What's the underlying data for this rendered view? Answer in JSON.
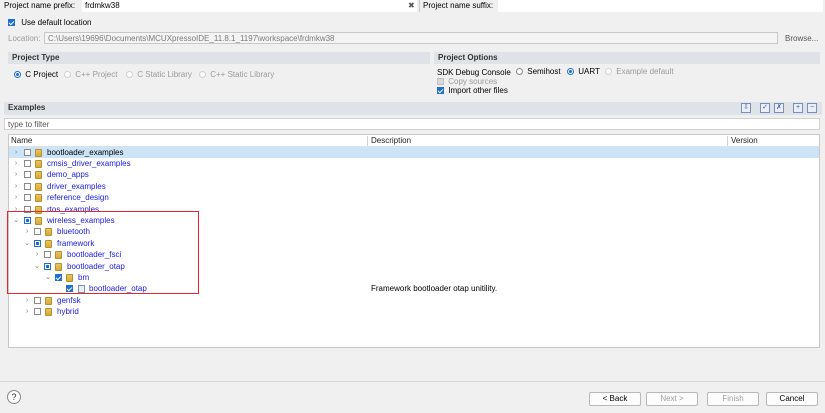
{
  "top": {
    "prefix_label": "Project name prefix:",
    "prefix_value": "frdmkw38",
    "clear_symbol": "✖",
    "suffix_label": "Project name suffix:",
    "suffix_value": ""
  },
  "location": {
    "default_label": "Use default location",
    "default_checked": true,
    "label": "Location:",
    "value": "C:\\Users\\19696\\Documents\\MCUXpressoIDE_11.8.1_1197\\workspace\\frdmkw38",
    "browse": "Browse..."
  },
  "project_type": {
    "title": "Project Type",
    "options": [
      {
        "label": "C Project",
        "selected": true
      },
      {
        "label": "C++ Project",
        "selected": false
      },
      {
        "label": "C Static Library",
        "selected": false
      },
      {
        "label": "C++ Static Library",
        "selected": false
      }
    ]
  },
  "project_options": {
    "title": "Project Options",
    "sdk_debug_label": "SDK Debug Console",
    "sdk_options": [
      {
        "label": "Semihost",
        "selected": false
      },
      {
        "label": "UART",
        "selected": true
      },
      {
        "label": "Example default",
        "selected": false
      }
    ],
    "copy_sources": "Copy sources",
    "import_other": "Import other files"
  },
  "examples": {
    "title": "Examples",
    "filter_placeholder": "type to filter",
    "columns": [
      "Name",
      "Description",
      "Version"
    ],
    "rows": [
      {
        "name": "bootloader_examples",
        "desc": ""
      },
      {
        "name": "cmsis_driver_examples",
        "desc": ""
      },
      {
        "name": "demo_apps",
        "desc": ""
      },
      {
        "name": "driver_examples",
        "desc": ""
      },
      {
        "name": "reference_design",
        "desc": ""
      },
      {
        "name": "rtos_examples",
        "desc": ""
      },
      {
        "name": "wireless_examples",
        "desc": ""
      },
      {
        "name": "bluetooth",
        "desc": ""
      },
      {
        "name": "framework",
        "desc": ""
      },
      {
        "name": "bootloader_fsci",
        "desc": ""
      },
      {
        "name": "bootloader_otap",
        "desc": ""
      },
      {
        "name": "bm",
        "desc": ""
      },
      {
        "name": "bootloader_otap",
        "desc": "Framework bootloader otap unitility."
      },
      {
        "name": "genfsk",
        "desc": ""
      },
      {
        "name": "hybrid",
        "desc": ""
      }
    ]
  },
  "buttons": {
    "help": "?",
    "back": "< Back",
    "next": "Next >",
    "finish": "Finish",
    "cancel": "Cancel"
  },
  "colors": {
    "highlight_box": "#e0282e",
    "link": "#1a1ae0",
    "selection": "#cce4f7"
  }
}
